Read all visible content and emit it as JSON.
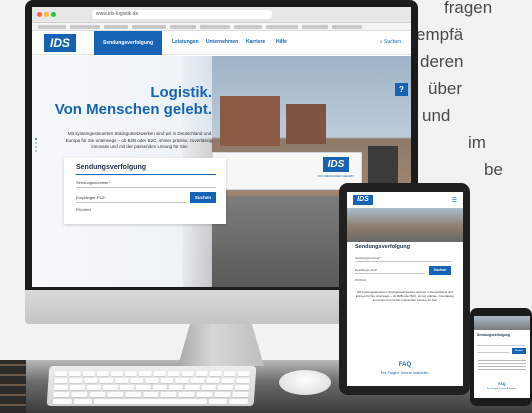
{
  "background_text": [
    "fragen",
    "empfä",
    "deren",
    "über",
    "und",
    "im",
    "be"
  ],
  "browser": {
    "url": "www.ids-logistik.de",
    "traffic_lights": [
      "#ff5f57",
      "#febc2e",
      "#28c840"
    ]
  },
  "site": {
    "logo": "IDS",
    "nav": [
      "Sendungsverfolgung",
      "Leistungen",
      "Unternehmen",
      "Karriere",
      "Hilfe"
    ],
    "search_label": "Suchen",
    "brand_color": "#1763b3",
    "help_button": "?"
  },
  "hero": {
    "title_line1": "Logistik.",
    "title_line2": "Von Menschen gelebt.",
    "copy": "Mit systemgesteuerten Stückgutnetzwerken sind wir in Deutschland und Europa für Sie unterwegs – ob B2B oder B2C, immer präzise, zuverlässig, innovativ und mit der passenden Lösung für Sie!",
    "truck_logo": "IDS",
    "truck_slogan": "VON MENSCHEN GELEBT"
  },
  "tracking": {
    "title": "Sendungsverfolgung",
    "field1_placeholder": "Sendungsnummer*",
    "field2_placeholder": "Empfänger-PLZ*",
    "button": "Suchen",
    "note": "Pflichtfeld"
  },
  "tablet": {
    "logo": "IDS",
    "title": "Sendungsverfolgung",
    "field1": "Sendungsnummer*",
    "field2": "Empfänger-PLZ*",
    "button": "Suchen",
    "note": "Pflichtfeld",
    "copy": "Mit systemgesteuerten Stückgutnetzwerken sind wir in Deutschland und Europa für Sie unterwegs – ob B2B oder B2C, immer präzise, zuverlässig, innovativ und mit der passenden Lösung für Sie!",
    "faq_title": "FAQ",
    "faq_sub": "Ihre Fragen. Unsere Antworten."
  },
  "phone": {
    "title": "Sendungsverfolgung",
    "button": "Suchen",
    "faq_title": "FAQ",
    "faq_sub": "Ihre Fragen. Unsere Antworten."
  }
}
